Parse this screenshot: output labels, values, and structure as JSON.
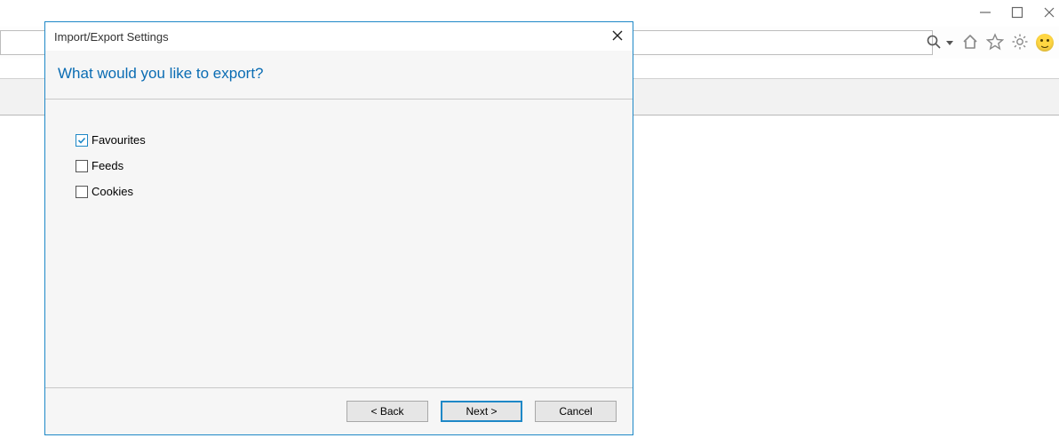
{
  "window_controls": {
    "minimize": "minimize",
    "maximize": "maximize",
    "close": "close"
  },
  "toolbar": {
    "search_icon": "search",
    "dropdown": "dropdown",
    "home_icon": "home",
    "favorites_icon": "favorites",
    "settings_icon": "settings",
    "smiley_icon": "smiley"
  },
  "dialog": {
    "title": "Import/Export Settings",
    "heading": "What would you like to export?",
    "options": [
      {
        "label": "Favourites",
        "checked": true
      },
      {
        "label": "Feeds",
        "checked": false
      },
      {
        "label": "Cookies",
        "checked": false
      }
    ],
    "buttons": {
      "back": "< Back",
      "next": "Next >",
      "cancel": "Cancel"
    }
  }
}
